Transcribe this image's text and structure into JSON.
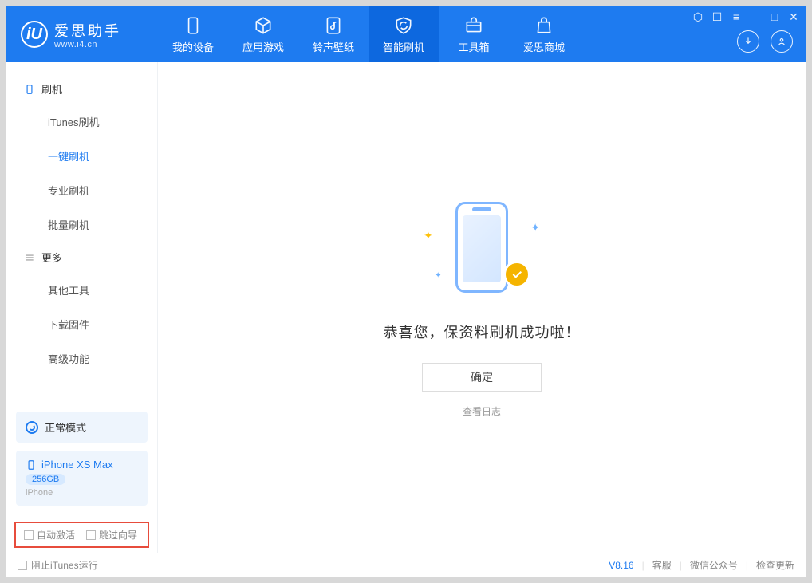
{
  "app": {
    "name": "爱思助手",
    "site": "www.i4.cn",
    "logo_letter": "iU"
  },
  "tabs": {
    "device": "我的设备",
    "apps": "应用游戏",
    "ringtone": "铃声壁纸",
    "flash": "智能刷机",
    "tools": "工具箱",
    "mall": "爱思商城"
  },
  "sidebar": {
    "section1": "刷机",
    "items1": [
      "iTunes刷机",
      "一键刷机",
      "专业刷机",
      "批量刷机"
    ],
    "section2": "更多",
    "items2": [
      "其他工具",
      "下载固件",
      "高级功能"
    ]
  },
  "mode": {
    "label": "正常模式"
  },
  "device": {
    "name": "iPhone XS Max",
    "capacity": "256GB",
    "type": "iPhone"
  },
  "options": {
    "auto_activate": "自动激活",
    "skip_wizard": "跳过向导"
  },
  "main": {
    "success_msg": "恭喜您，保资料刷机成功啦！",
    "ok": "确定",
    "view_log": "查看日志"
  },
  "status": {
    "block_itunes": "阻止iTunes运行",
    "version": "V8.16",
    "support": "客服",
    "wechat": "微信公众号",
    "update": "检查更新"
  }
}
